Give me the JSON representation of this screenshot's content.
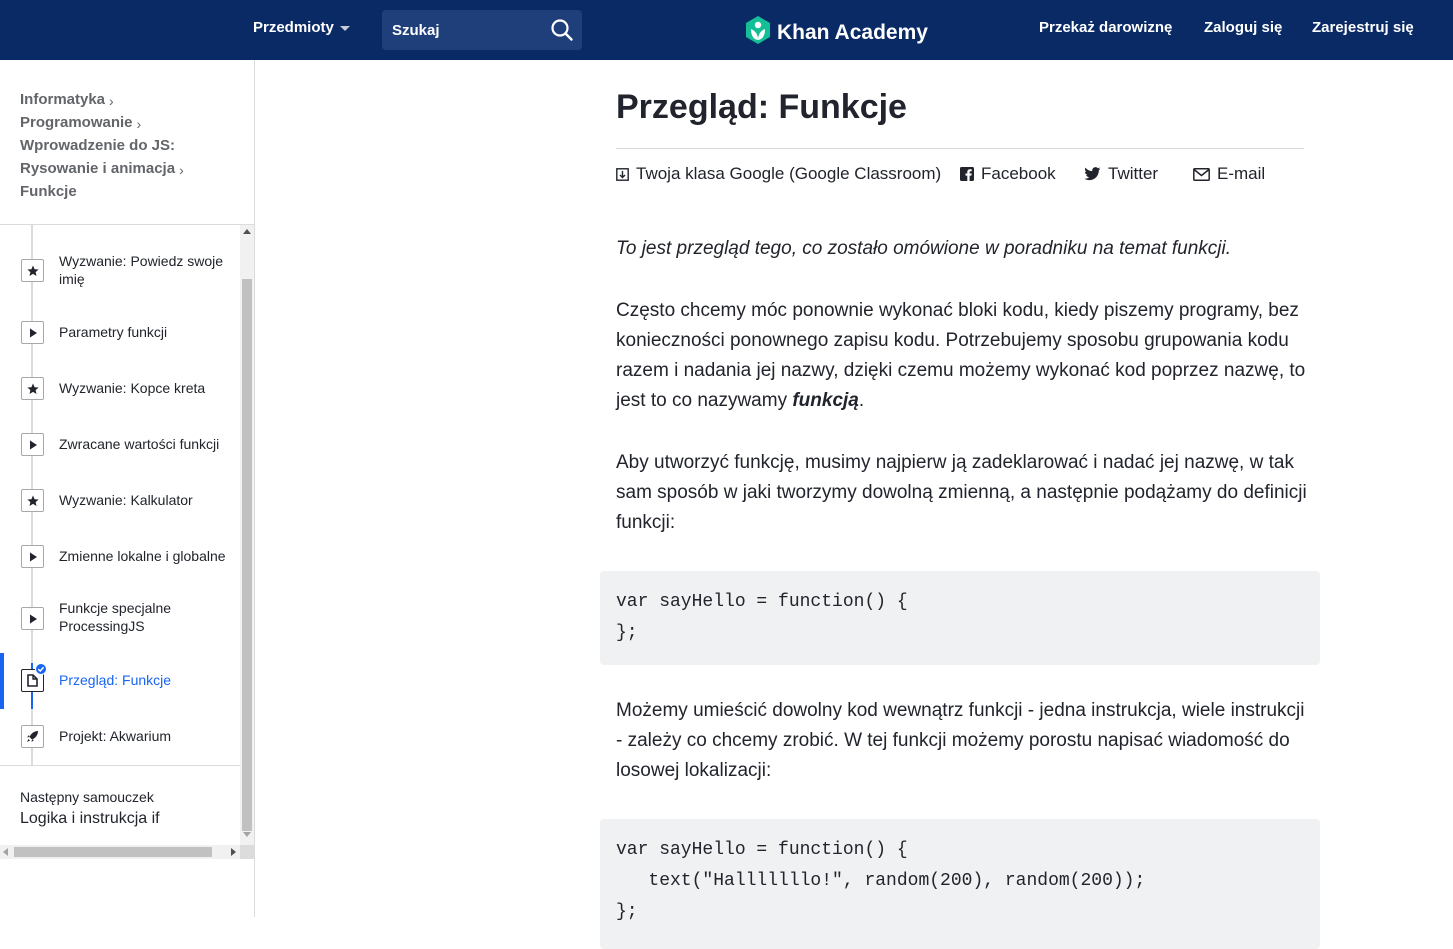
{
  "header": {
    "subjects_label": "Przedmioty",
    "search_placeholder": "Szukaj",
    "logo_text": "Khan Academy",
    "donate_label": "Przekaż darowiznę",
    "login_label": "Zaloguj się",
    "signup_label": "Zarejestruj się",
    "brand_color": "#0a2a66",
    "logo_color": "#14bf96"
  },
  "sidebar": {
    "breadcrumbs": [
      "Informatyka",
      "Programowanie",
      "Wprowadzenie do JS:",
      "Rysowanie i animacja",
      "Funkcje"
    ],
    "items": [
      {
        "label": "Wyzwanie: Powiedz swoje imię",
        "icon": "star-icon"
      },
      {
        "label": "Parametry funkcji",
        "icon": "play-icon"
      },
      {
        "label": "Wyzwanie: Kopce kreta",
        "icon": "star-icon"
      },
      {
        "label": "Zwracane wartości funkcji",
        "icon": "play-icon"
      },
      {
        "label": "Wyzwanie: Kalkulator",
        "icon": "star-icon"
      },
      {
        "label": "Zmienne lokalne i globalne",
        "icon": "play-icon"
      },
      {
        "label": "Funkcje specjalne ProcessingJS",
        "icon": "play-icon"
      },
      {
        "label": "Przegląd: Funkcje",
        "icon": "article-icon",
        "active": true
      },
      {
        "label": "Projekt: Akwarium",
        "icon": "rocket-icon"
      }
    ],
    "next_label": "Następny samouczek",
    "next_title": "Logika i instrukcja if",
    "active_color": "#1865f2"
  },
  "article": {
    "title": "Przegląd: Funkcje",
    "share": {
      "classroom": "Twoja klasa Google (Google Classroom)",
      "facebook": "Facebook",
      "twitter": "Twitter",
      "email": "E-mail"
    },
    "intro": "To jest przegląd tego, co zostało omówione w poradniku na temat funkcji.",
    "p1_before": "Często chcemy móc ponownie wykonać bloki kodu, kiedy piszemy programy, bez konieczności ponownego zapisu kodu. Potrzebujemy sposobu grupowania kodu razem i nadania jej nazwy, dzięki czemu możemy wykonać kod poprzez nazwę, to jest to co nazywamy ",
    "p1_bold": "funkcją",
    "p1_after": ".",
    "p2": "Aby utworzyć funkcję, musimy najpierw ją zadeklarować i nadać jej nazwę, w tak sam sposób w jaki tworzymy dowolną zmienną, a następnie podążamy do definicji funkcji:",
    "code1": "var sayHello = function() {\n};",
    "p3": "Możemy umieścić dowolny kod wewnątrz funkcji - jedna instrukcja, wiele instrukcji - zależy co chcemy zrobić. W tej funkcji możemy porostu napisać wiadomość do losowej lokalizacji:",
    "code2": "var sayHello = function() {\n   text(\"Halllllllo!\", random(200), random(200));\n};"
  }
}
